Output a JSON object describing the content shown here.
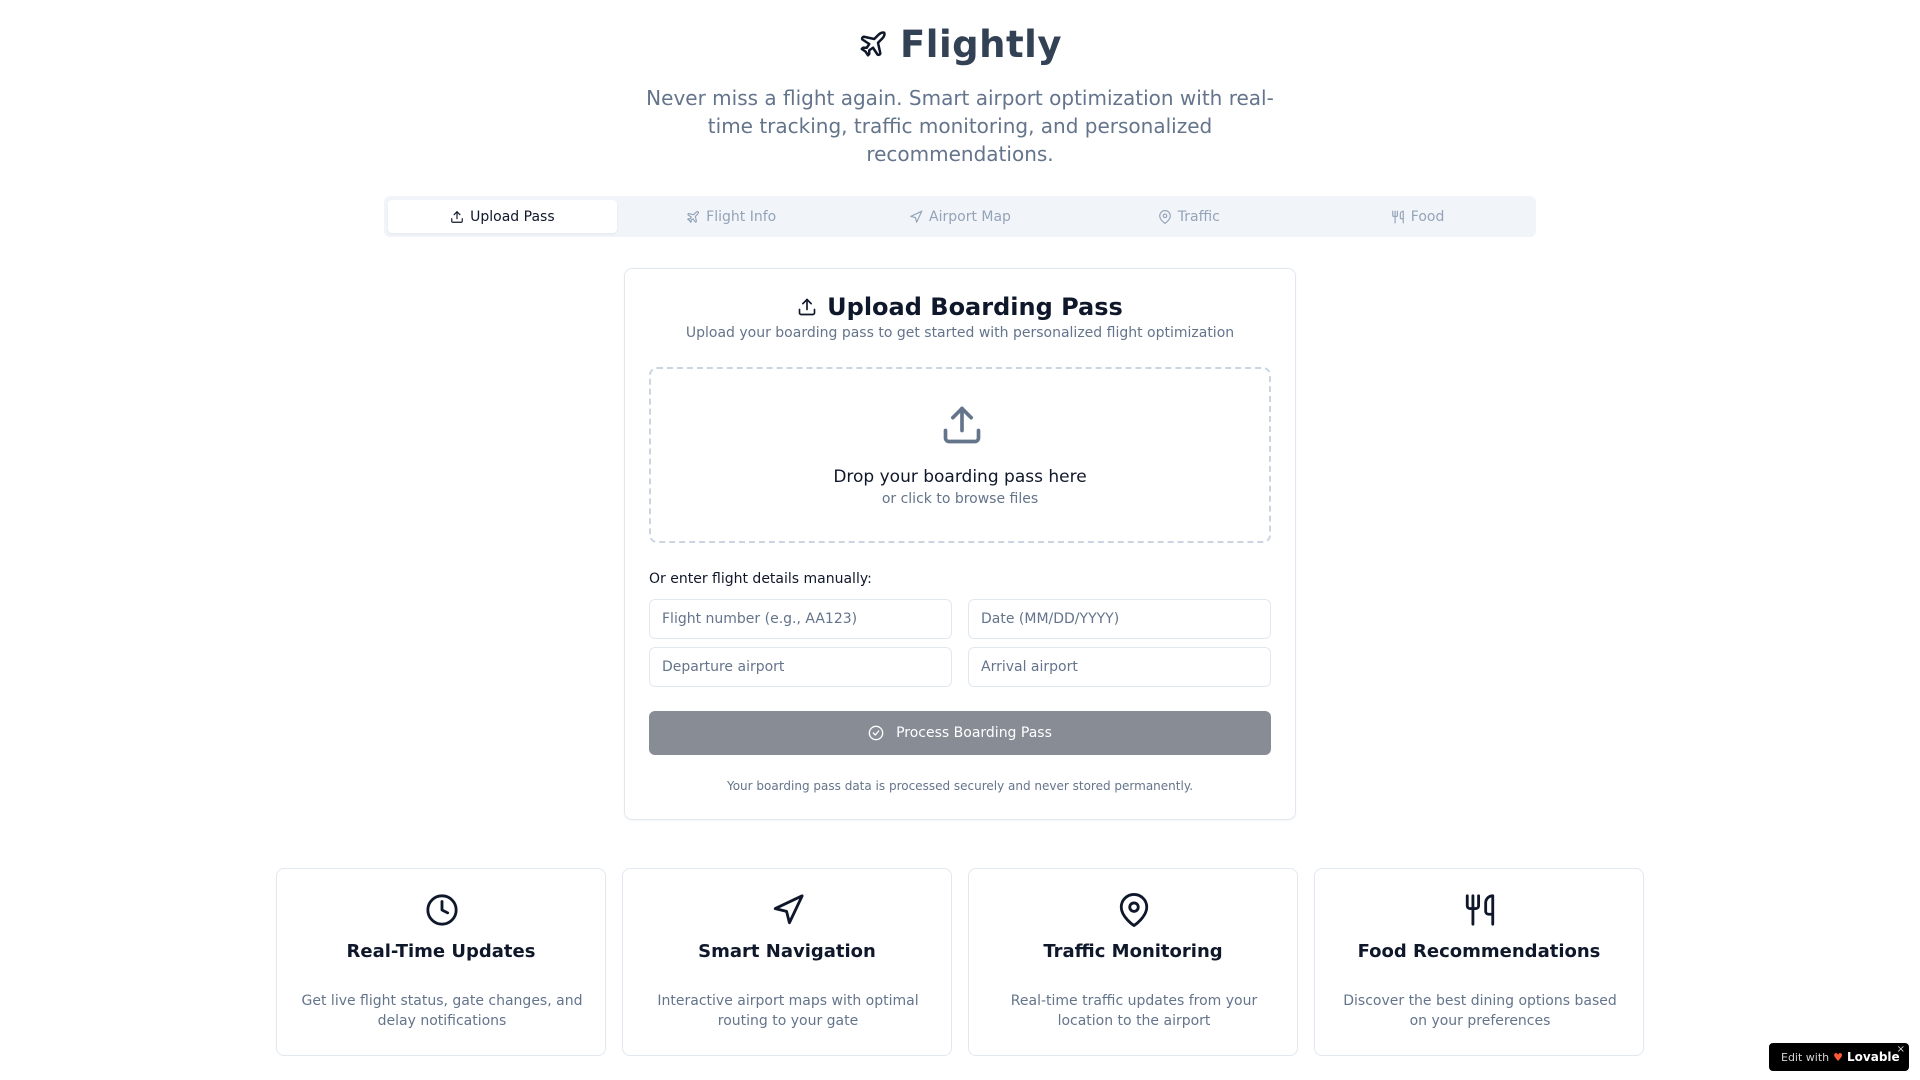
{
  "app": {
    "name": "Flightly",
    "tagline": "Never miss a flight again. Smart airport optimization with real-time tracking, traffic monitoring, and personalized recommendations."
  },
  "tabs": [
    {
      "label": "Upload Pass",
      "icon": "upload-icon",
      "active": true
    },
    {
      "label": "Flight Info",
      "icon": "plane-icon",
      "active": false
    },
    {
      "label": "Airport Map",
      "icon": "navigation-icon",
      "active": false
    },
    {
      "label": "Traffic",
      "icon": "map-pin-icon",
      "active": false
    },
    {
      "label": "Food",
      "icon": "utensils-icon",
      "active": false
    }
  ],
  "upload_card": {
    "title": "Upload Boarding Pass",
    "subtitle": "Upload your boarding pass to get started with personalized flight optimization",
    "dropzone": {
      "title": "Drop your boarding pass here",
      "subtitle": "or click to browse files"
    },
    "manual_label": "Or enter flight details manually:",
    "fields": {
      "flight_number": {
        "placeholder": "Flight number (e.g., AA123)",
        "value": ""
      },
      "date": {
        "placeholder": "Date (MM/DD/YYYY)",
        "value": ""
      },
      "departure": {
        "placeholder": "Departure airport",
        "value": ""
      },
      "arrival": {
        "placeholder": "Arrival airport",
        "value": ""
      }
    },
    "process_button": "Process Boarding Pass",
    "secure_note": "Your boarding pass data is processed securely and never stored permanently."
  },
  "features": [
    {
      "icon": "clock-icon",
      "title": "Real-Time Updates",
      "description": "Get live flight status, gate changes, and delay notifications"
    },
    {
      "icon": "navigation-icon",
      "title": "Smart Navigation",
      "description": "Interactive airport maps with optimal routing to your gate"
    },
    {
      "icon": "map-pin-icon",
      "title": "Traffic Monitoring",
      "description": "Real-time traffic updates from your location to the airport"
    },
    {
      "icon": "utensils-icon",
      "title": "Food Recommendations",
      "description": "Discover the best dining options based on your preferences"
    }
  ],
  "badge": {
    "edit_text": "Edit with",
    "brand": "Lovable",
    "close": "×"
  },
  "colors": {
    "brand_text": "#334155",
    "muted": "#64748b",
    "button_disabled": "#878c95",
    "border": "#e2e8f0"
  }
}
